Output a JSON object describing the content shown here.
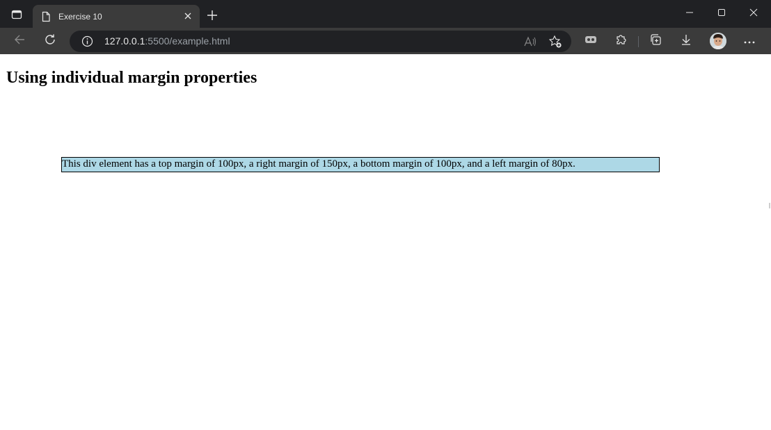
{
  "browser": {
    "tab": {
      "title": "Exercise 10"
    },
    "address": {
      "host": "127.0.0.1",
      "path": ":5500/example.html"
    }
  },
  "page": {
    "heading": "Using individual margin properties",
    "box_text": "This div element has a top margin of 100px, a right margin of 150px, a bottom margin of 100px, and a left margin of 80px.",
    "box_color": "#add8e6"
  },
  "icons": {
    "tab_actions": "tab-actions-icon",
    "page": "page-icon",
    "close": "close-icon",
    "new_tab": "plus-icon",
    "minimize": "minimize-icon",
    "maximize": "maximize-icon",
    "window_close": "close-icon",
    "back": "back-arrow-icon",
    "refresh": "refresh-icon",
    "info": "info-icon",
    "read_aloud": "read-aloud-icon",
    "favorites": "add-favorite-icon",
    "extension_app": "gamepad-icon",
    "extensions": "puzzle-icon",
    "collections": "collections-icon",
    "downloads": "download-icon",
    "profile": "avatar",
    "menu": "more-icon"
  }
}
